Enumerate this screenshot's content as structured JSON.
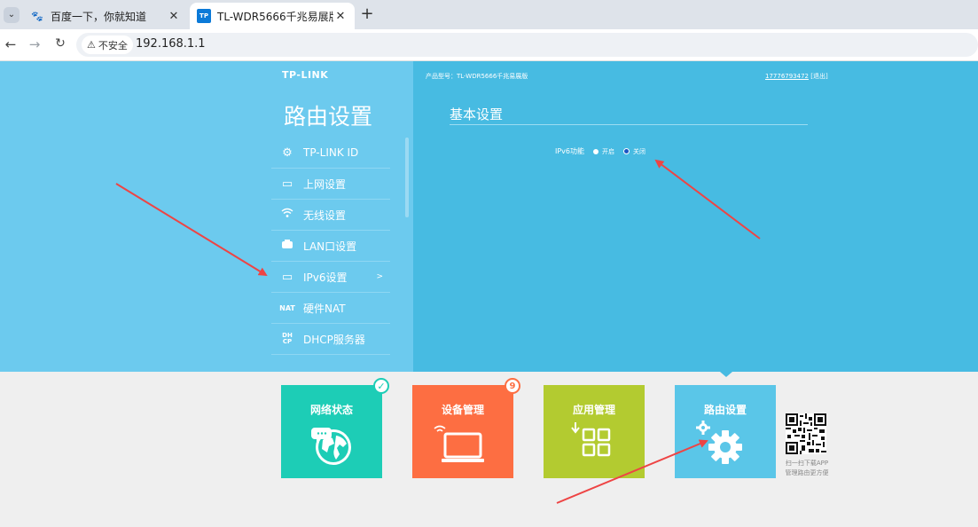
{
  "browser": {
    "tabs": [
      {
        "title": "百度一下，你就知道",
        "icon": "baidu-paw-icon",
        "active": false
      },
      {
        "title": "TL-WDR5666千兆易展版",
        "icon": "tp-link-favicon",
        "active": true
      }
    ],
    "security_label": "不安全",
    "url": "192.168.1.1"
  },
  "router": {
    "logo": "TP-LINK",
    "section_title": "路由设置",
    "model_label": "产品型号：TL-WDR5666千兆易展版",
    "phone": "17776793472",
    "logout": "[退出]",
    "menu": [
      {
        "label": "TP-LINK ID",
        "icon": "gear-icon"
      },
      {
        "label": "上网设置",
        "icon": "laptop-icon"
      },
      {
        "label": "无线设置",
        "icon": "wifi-icon"
      },
      {
        "label": "LAN口设置",
        "icon": "lan-icon"
      },
      {
        "label": "IPv6设置",
        "icon": "laptop-icon",
        "active": true,
        "chevron": ">"
      },
      {
        "label": "硬件NAT",
        "icon": "nat-icon"
      },
      {
        "label": "DHCP服务器",
        "icon": "dhcp-icon"
      }
    ],
    "panel_title": "基本设置",
    "ipv6": {
      "label": "IPv6功能",
      "option_on": "开启",
      "option_off": "关闭",
      "selected": "关闭"
    },
    "tiles": [
      {
        "label": "网络状态",
        "icon": "globe-chat-icon",
        "badge": "✓",
        "color": "#1dcdb6"
      },
      {
        "label": "设备管理",
        "icon": "laptop-wifi-icon",
        "badge": "9",
        "color": "#fd6e42"
      },
      {
        "label": "应用管理",
        "icon": "apps-grid-icon",
        "color": "#b3cb30"
      },
      {
        "label": "路由设置",
        "icon": "gears-icon",
        "color": "#5ac6e8"
      }
    ],
    "qr_caption_line1": "扫一扫下载APP",
    "qr_caption_line2": "管理路由更方便"
  }
}
